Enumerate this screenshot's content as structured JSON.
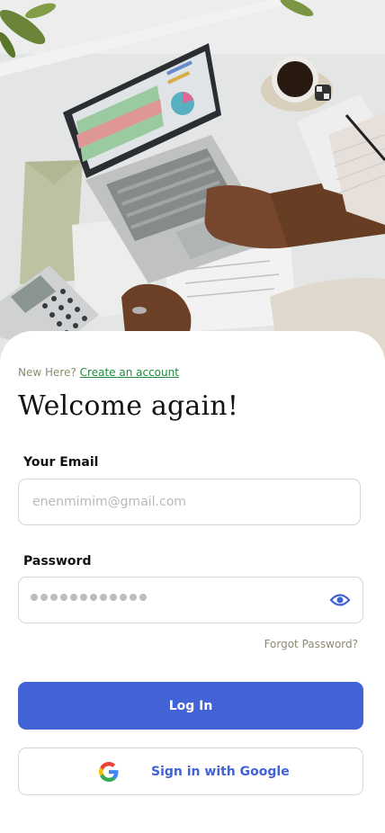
{
  "header": {
    "prompt": "New Here?",
    "create_account_link": "Create an account",
    "title": "Welcome again!"
  },
  "form": {
    "email_label": "Your Email",
    "email_placeholder": "enenmimim@gmail.com",
    "password_label": "Password",
    "password_masked_length": 12,
    "forgot_password": "Forgot Password?"
  },
  "actions": {
    "login_label": "Log In",
    "google_label": "Sign in with Google"
  },
  "colors": {
    "primary": "#4263d6",
    "link_green": "#1f8a3b",
    "muted_text": "#8d8a6e"
  }
}
